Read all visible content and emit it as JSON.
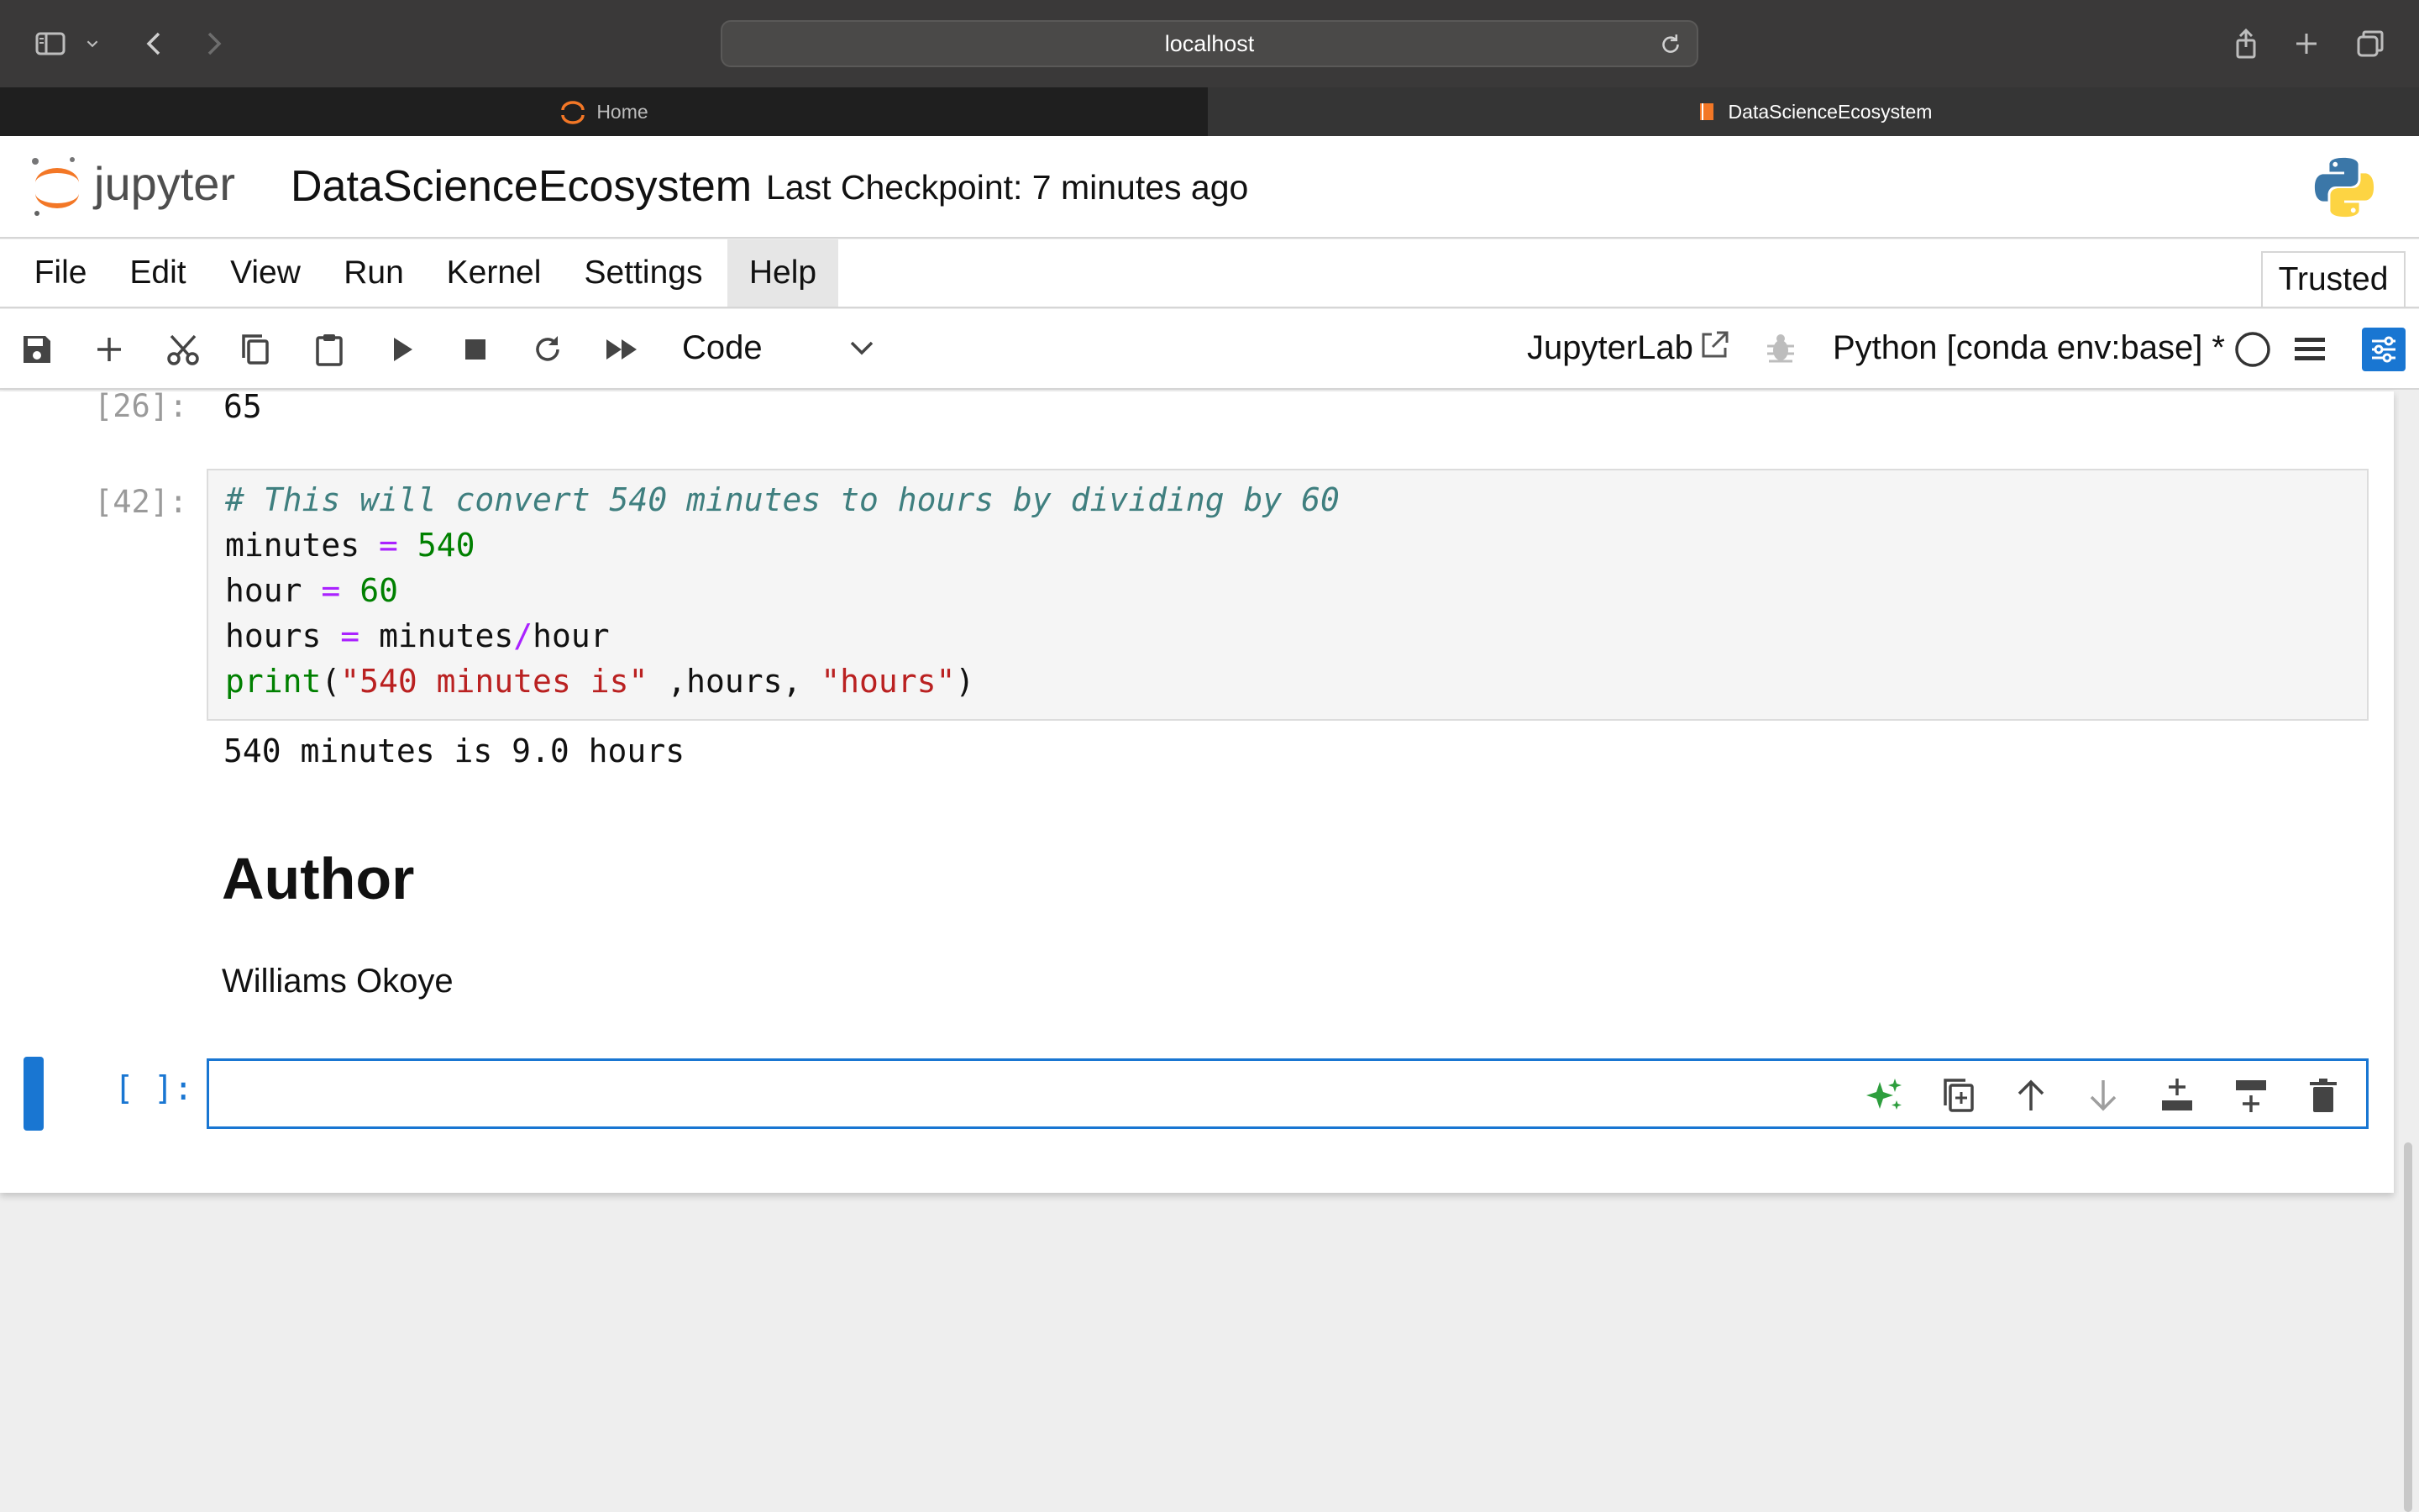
{
  "browser": {
    "address": "localhost",
    "tabs": [
      {
        "label": "Home"
      },
      {
        "label": "DataScienceEcosystem"
      }
    ]
  },
  "header": {
    "logo_text": "jupyter",
    "notebook_title": "DataScienceEcosystem",
    "checkpoint": "Last Checkpoint: 7 minutes ago"
  },
  "menu": {
    "items": [
      "File",
      "Edit",
      "View",
      "Run",
      "Kernel",
      "Settings",
      "Help"
    ],
    "trusted": "Trusted"
  },
  "toolbar": {
    "cell_type": "Code",
    "jupyterlab_link": "JupyterLab",
    "kernel": "Python [conda env:base] *"
  },
  "cells": {
    "output_26": {
      "prompt": "[26]:",
      "text": "65"
    },
    "code_42": {
      "prompt": "[42]:",
      "comment": "# This will convert 540 minutes to hours by dividing by 60",
      "l2_var": "minutes",
      "l2_op": "=",
      "l2_num": "540",
      "l3_var": "hour",
      "l3_op": "=",
      "l3_num": "60",
      "l4_var": "hours",
      "l4_op": "=",
      "l4_a": "minutes",
      "l4_div": "/",
      "l4_b": "hour",
      "l5_fn": "print",
      "l5_open": "(",
      "l5_str1": "\"540 minutes is\"",
      "l5_mid": " ,hours, ",
      "l5_str2": "\"hours\"",
      "l5_close": ")",
      "output": "540 minutes is 9.0 hours"
    },
    "markdown": {
      "heading": "Author",
      "text": "Williams Okoye"
    },
    "empty": {
      "prompt": "[ ]:"
    }
  },
  "colors": {
    "accent": "#1976d2",
    "jupyter_orange": "#f37726",
    "cell_bg": "#f5f5f5"
  }
}
